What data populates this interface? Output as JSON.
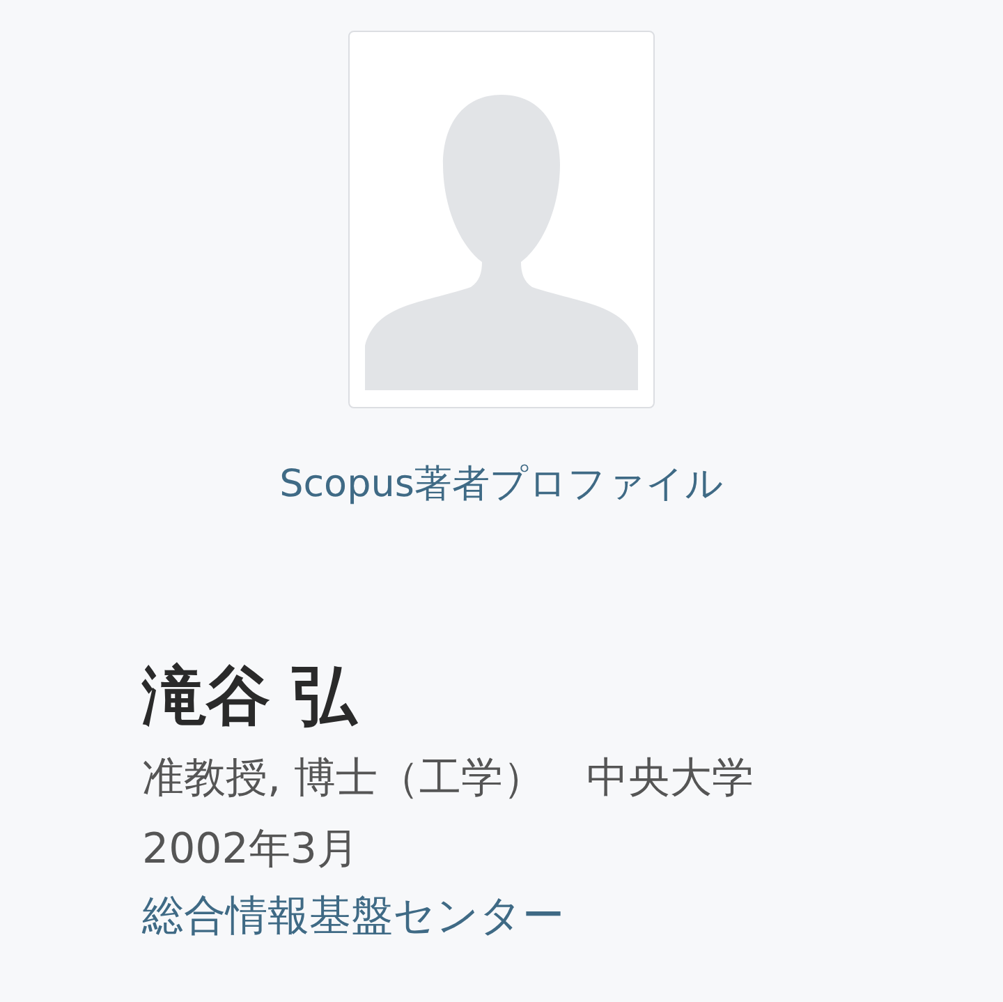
{
  "scopus_link": "Scopus著者プロファイル",
  "name": "滝谷 弘",
  "position_line": [
    "准教授, 博士（工学）",
    "中央大学"
  ],
  "date": "2002年3月",
  "affiliation": "総合情報基盤センター"
}
